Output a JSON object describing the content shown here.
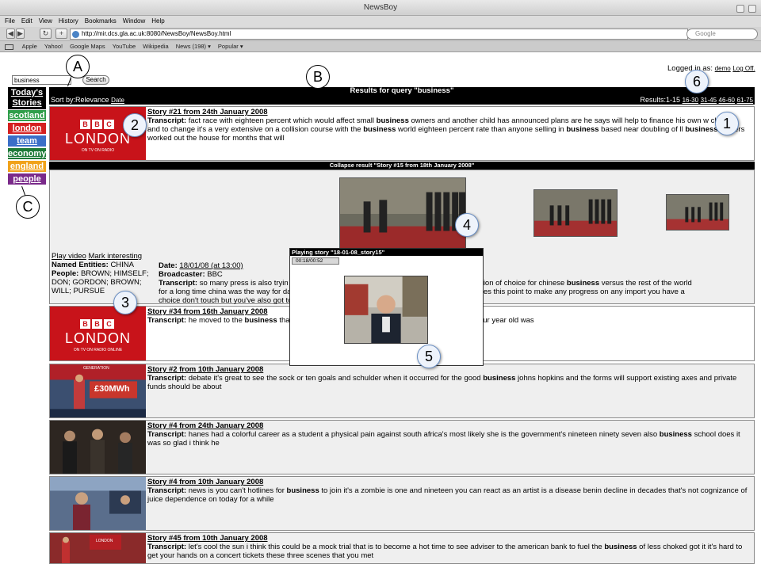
{
  "browser": {
    "window_title": "NewsBoy",
    "menu": [
      "File",
      "Edit",
      "View",
      "History",
      "Bookmarks",
      "Window",
      "Help"
    ],
    "url": "http://mir.dcs.gla.ac.uk:8080/NewsBoy/NewsBoy.html",
    "search_placeholder": "Google",
    "bookmarks": [
      "Apple",
      "Yahoo!",
      "Google Maps",
      "YouTube",
      "Wikipedia",
      "News (198) ▾",
      "Popular ▾"
    ]
  },
  "search": {
    "value": "business",
    "button": "Search"
  },
  "login": {
    "label": "Logged in as:",
    "user": "demo",
    "logoff": "Log Off."
  },
  "sidebar": {
    "todays": "Today's Stories",
    "categories": [
      {
        "label": "scotland",
        "color": "#2f9e4a"
      },
      {
        "label": "london",
        "color": "#d42020"
      },
      {
        "label": "team",
        "color": "#3a6fc8"
      },
      {
        "label": "economy",
        "color": "#1d7a38"
      },
      {
        "label": "england",
        "color": "#f0a21a"
      },
      {
        "label": "people",
        "color": "#7a2a8a"
      }
    ]
  },
  "results": {
    "header": "Results for query \"business\"",
    "sort_label": "Sort by:Relevance",
    "sort_date": "Date",
    "range_label": "Results:1-15",
    "pages": [
      "16-30",
      "31-45",
      "46-60",
      "61-75"
    ]
  },
  "stories": [
    {
      "title": "Story #21 from 24th January 2008",
      "transcript": [
        {
          "t": "Transcript: ",
          "b": true
        },
        {
          "t": "fact race with eighteen percent which would affect small "
        },
        {
          "t": "business",
          "b": true
        },
        {
          "t": " owners and another child has announced plans are he says will help to finance his own w"
        },
        {
          "t": " children and to change it's a very extensive on a collision course with the "
        },
        {
          "t": "business",
          "b": true
        },
        {
          "t": " world eighteen percent rate than anyone selling in "
        },
        {
          "t": "business",
          "b": true
        },
        {
          "t": " based near doubling of "
        },
        {
          "t": " ll "
        },
        {
          "t": "business",
          "b": true
        },
        {
          "t": " leaders worked out the house for months that will"
        }
      ]
    },
    {
      "title": "Story #34 from 16th January 2008",
      "transcript": [
        {
          "t": "Transcript: ",
          "b": true
        },
        {
          "t": "he moved to the "
        },
        {
          "t": "business",
          "b": true
        },
        {
          "t": " tha"
        },
        {
          "t": "                                                                                                    "
        },
        {
          "t": "'s going to a celebration prime minister soon slight i felt four year old was"
        }
      ]
    },
    {
      "title": "Story #2 from 10th January 2008",
      "transcript": [
        {
          "t": "Transcript: ",
          "b": true
        },
        {
          "t": "debate it's great to see the sock or ten goals and schulder when it occurred for the good "
        },
        {
          "t": "business",
          "b": true
        },
        {
          "t": " johns hopkins and the forms will support existing axes and private funds should be about"
        }
      ]
    },
    {
      "title": "Story #4 from 24th January 2008",
      "transcript": [
        {
          "t": "Transcript: ",
          "b": true
        },
        {
          "t": "hanes had a colorful career as a student a physical pain against south africa's most likely she is the government's nineteen ninety seven also "
        },
        {
          "t": "business",
          "b": true
        },
        {
          "t": " school does it was so glad i think he"
        }
      ]
    },
    {
      "title": "Story #4 from 10th January 2008",
      "transcript": [
        {
          "t": "Transcript: ",
          "b": true
        },
        {
          "t": "news is you can't hotlines for "
        },
        {
          "t": "business",
          "b": true
        },
        {
          "t": " to join it's a zombie is one and nineteen you can react as an artist is a disease benin decline in decades that's not cognizance of juice dependence on today for a while"
        }
      ]
    },
    {
      "title": "Story #45 from 10th January 2008",
      "transcript": [
        {
          "t": "Transcript: ",
          "b": true
        },
        {
          "t": "let's cool the sun i think this could be a mock trial that is to become a hot time to see adviser to the american bank to fuel the "
        },
        {
          "t": "business",
          "b": true
        },
        {
          "t": " of less choked got it it's hard to get your hands on a concert tickets these three scenes that you met"
        }
      ]
    }
  ],
  "bbc_logo": {
    "letters": [
      "B",
      "B",
      "C"
    ],
    "word": "LONDON",
    "sub1": "ON TV  ON RADIO",
    "sub2": "ON TV  ON RADIO  ONLINE"
  },
  "thumb_captions": {
    "thumb_sign": "GENERATION",
    "thumb_price": "£30MWh"
  },
  "expanded": {
    "collapse": "Collapse result \"Story #15 from 18th January 2008\"",
    "play": "Play video",
    "mark": "Mark interesting",
    "named_entities_label": "Named Entities:",
    "named_entities": "CHINA",
    "people_label": "People:",
    "people": "BROWN; HIMSELF; DON; GORDON; BROWN; WILL; PURSUE",
    "date_label": "Date:",
    "date": "18/01/08 (at 13:00)",
    "broadcaster_label": "Broadcaster:",
    "broadcaster": "BBC",
    "transcript_label": "Transcript:",
    "transcript_a": "so many press is also tryin",
    "transcript_b": "ber one destination of choice for chinese ",
    "transcript_b_bold": "business",
    "transcript_c": " versus the rest of the world",
    "transcript_line2a": "for a long time china was the way for da",
    "transcript_line2b": "ything that makes this point to make any progress on any import you have a",
    "transcript_line3": "choice don't touch but you've also got to"
  },
  "popup": {
    "title": "Playing story \"18-01-08_story15\"",
    "time": "00:18/00:52"
  },
  "callouts": [
    "A",
    "B",
    "C",
    "1",
    "2",
    "3",
    "4",
    "5",
    "6"
  ]
}
